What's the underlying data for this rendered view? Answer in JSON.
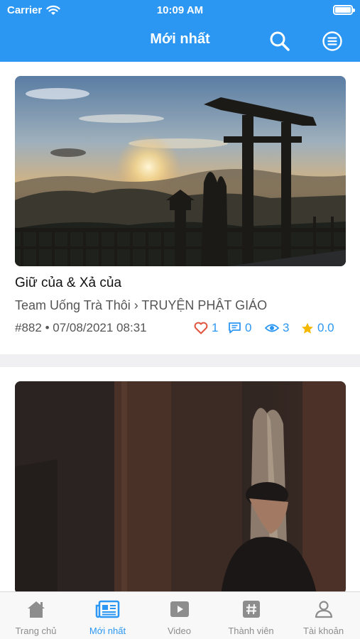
{
  "status_bar": {
    "carrier": "Carrier",
    "time": "10:09 AM"
  },
  "nav": {
    "title": "Mới nhất",
    "search_icon": "search-icon",
    "menu_icon": "menu-circle-icon"
  },
  "posts": [
    {
      "title": "Giữ của & Xả của",
      "source": "Team Uống Trà Thôi › TRUYỆN PHẬT GIÁO",
      "id": "#882",
      "separator": "•",
      "datetime": "07/08/2021 08:31",
      "likes": "1",
      "comments": "0",
      "views": "3",
      "rating": "0.0",
      "image": "temple-gate-sunset-photo"
    },
    {
      "image": "monk-interior-photo"
    }
  ],
  "tabs": [
    {
      "label": "Trang chủ",
      "icon": "home-icon"
    },
    {
      "label": "Mới nhất",
      "icon": "newspaper-icon"
    },
    {
      "label": "Video",
      "icon": "play-icon"
    },
    {
      "label": "Thành viên",
      "icon": "hashtag-icon"
    },
    {
      "label": "Tài khoản",
      "icon": "user-icon"
    }
  ],
  "colors": {
    "accent": "#2b97f3",
    "like": "#e0533d",
    "comment": "#2b97f3",
    "view": "#2b97f3",
    "star": "#f5b800",
    "tab_inactive": "#8d8d8d"
  }
}
